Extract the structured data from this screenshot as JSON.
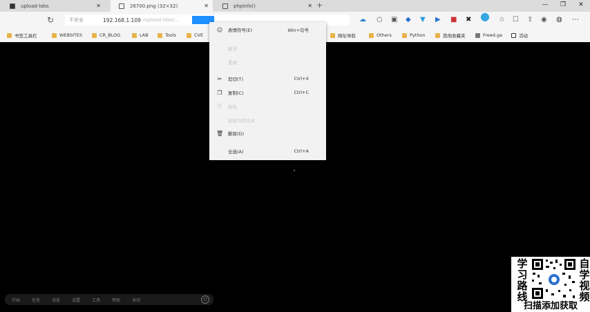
{
  "tabs": [
    {
      "label": "upload-labs"
    },
    {
      "label": "26700.png (32×32)"
    },
    {
      "label": "phpinfo()"
    }
  ],
  "toolbar": {
    "security_label": "不安全",
    "url": "192.168.1.109",
    "url_rest": "/upload-labs/..."
  },
  "bookmarks": [
    {
      "label": "书签工具栏"
    },
    {
      "label": "WEBSITES"
    },
    {
      "label": "CR_BLOG"
    },
    {
      "label": "LAB"
    },
    {
      "label": "Tools"
    },
    {
      "label": "CVE"
    },
    {
      "label": "网址导航"
    },
    {
      "label": "Others"
    },
    {
      "label": "Python"
    },
    {
      "label": "其他收藏夹"
    },
    {
      "label": "Freed.ga"
    },
    {
      "label": "活动"
    }
  ],
  "context_menu": {
    "items": [
      {
        "label": "表情符号(E)",
        "shortcut": "Win+句号",
        "icon": "smiley-icon",
        "enabled": true
      },
      {
        "label": "撤消",
        "shortcut": "",
        "icon": "",
        "enabled": false
      },
      {
        "label": "重做",
        "shortcut": "",
        "icon": "",
        "enabled": false
      },
      {
        "label": "剪切(T)",
        "shortcut": "Ctrl+X",
        "icon": "scissors-icon",
        "enabled": true
      },
      {
        "label": "复制(C)",
        "shortcut": "Ctrl+C",
        "icon": "copy-icon",
        "enabled": true
      },
      {
        "label": "粘贴",
        "shortcut": "",
        "icon": "paste-icon",
        "enabled": false
      },
      {
        "label": "粘贴为纯文本",
        "shortcut": "",
        "icon": "",
        "enabled": false
      },
      {
        "label": "删除(D)",
        "shortcut": "",
        "icon": "trash-icon",
        "enabled": true
      },
      {
        "label": "全选(A)",
        "shortcut": "Ctrl+A",
        "icon": "",
        "enabled": true
      }
    ]
  },
  "bottom_bar": {
    "items": [
      "开始",
      "任务",
      "消息",
      "设置",
      "工具",
      "帮助",
      "关闭"
    ]
  },
  "promo": {
    "left_text": [
      "学",
      "习",
      "路",
      "线"
    ],
    "right_text": [
      "自",
      "学",
      "视",
      "频"
    ],
    "bottom_text": "扫描添加获取"
  },
  "colors": {
    "selection": "#1e90ff",
    "menu_bg": "#f2f2f2",
    "tab_active": "#f5f5f5",
    "tab_strip": "#dcdcdc"
  }
}
